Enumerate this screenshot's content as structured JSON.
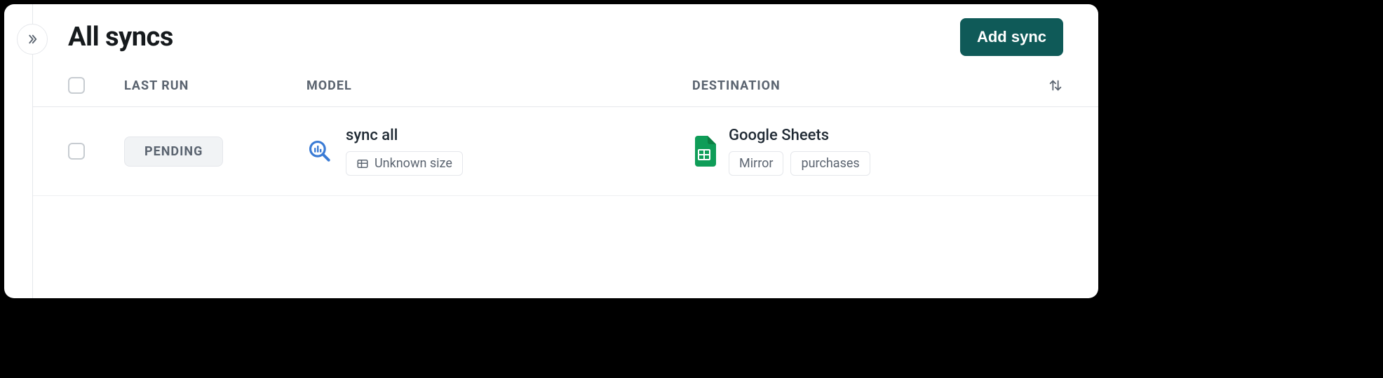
{
  "header": {
    "title": "All syncs",
    "add_button": "Add sync"
  },
  "columns": {
    "last_run": "LAST RUN",
    "model": "MODEL",
    "destination": "DESTINATION"
  },
  "rows": [
    {
      "status": "PENDING",
      "model": {
        "name": "sync all",
        "size_label": "Unknown size"
      },
      "destination": {
        "name": "Google Sheets",
        "tags": [
          "Mirror",
          "purchases"
        ]
      }
    }
  ]
}
